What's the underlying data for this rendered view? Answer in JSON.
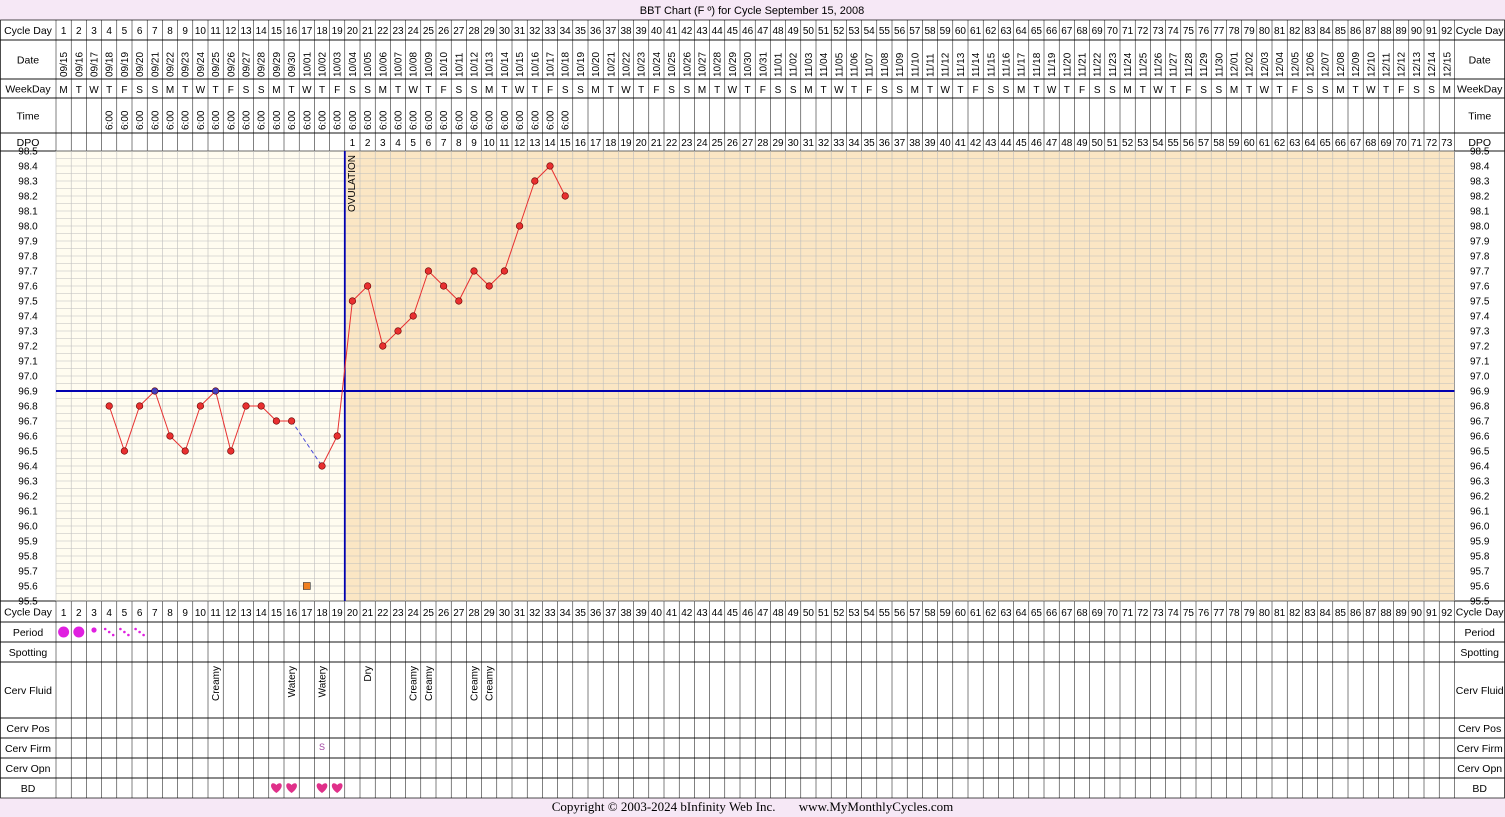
{
  "title": "BBT Chart (F º) for Cycle September 15, 2008",
  "labels": {
    "cycle_day": "Cycle Day",
    "date": "Date",
    "weekday": "WeekDay",
    "time": "Time",
    "dpo": "DPO",
    "period": "Period",
    "spotting": "Spotting",
    "cerv_fluid": "Cerv Fluid",
    "cerv_pos": "Cerv Pos",
    "cerv_firm": "Cerv Firm",
    "cerv_opn": "Cerv Opn",
    "bd": "BD"
  },
  "ovulation_label": "OVULATION",
  "copyright": "Copyright © 2003-2024 bInfinity Web Inc.",
  "site": "www.MyMonthlyCycles.com",
  "colors": {
    "background": "#f6e8f6",
    "pre_ovulation": "#fffcf0",
    "post_ovulation": "#fbe6c4",
    "grid": "#bdbdbd",
    "temp_line": "#e83030",
    "point_fill": "#e83030",
    "coverline": "#0000b0",
    "period_dot": "#e020e0",
    "bd_heart": "#e0308a",
    "marker": "#f08020"
  },
  "chart_data": {
    "type": "line",
    "title": "BBT Chart (F º) for Cycle September 15, 2008",
    "xlabel": "Cycle Day",
    "ylabel": "",
    "days": 92,
    "ylim": [
      95.5,
      98.5
    ],
    "y_ticks": [
      "98.5",
      "98.4",
      "98.3",
      "98.2",
      "98.1",
      "98.0",
      "97.9",
      "97.8",
      "97.7",
      "97.6",
      "97.5",
      "97.4",
      "97.3",
      "97.2",
      "97.1",
      "97.0",
      "96.9",
      "96.8",
      "96.7",
      "96.6",
      "96.5",
      "96.4",
      "96.3",
      "96.2",
      "96.1",
      "96.0",
      "95.9",
      "95.8",
      "95.7",
      "95.6",
      "95.5"
    ],
    "dates": [
      "09/15",
      "09/16",
      "09/17",
      "09/18",
      "09/19",
      "09/20",
      "09/21",
      "09/22",
      "09/23",
      "09/24",
      "09/25",
      "09/26",
      "09/27",
      "09/28",
      "09/29",
      "09/30",
      "10/01",
      "10/02",
      "10/03",
      "10/04",
      "10/05",
      "10/06",
      "10/07",
      "10/08",
      "10/09",
      "10/10",
      "10/11",
      "10/12",
      "10/13",
      "10/14",
      "10/15",
      "10/16",
      "10/17",
      "10/18",
      "10/19",
      "10/20",
      "10/21",
      "10/22",
      "10/23",
      "10/24",
      "10/25",
      "10/26",
      "10/27",
      "10/28",
      "10/29",
      "10/30",
      "10/31",
      "11/01",
      "11/02",
      "11/03",
      "11/04",
      "11/05",
      "11/06",
      "11/07",
      "11/08",
      "11/09",
      "11/10",
      "11/11",
      "11/12",
      "11/13",
      "11/14",
      "11/15",
      "11/16",
      "11/17",
      "11/18",
      "11/19",
      "11/20",
      "11/21",
      "11/22",
      "11/23",
      "11/24",
      "11/25",
      "11/26",
      "11/27",
      "11/28",
      "11/29",
      "11/30",
      "12/01",
      "12/02",
      "12/03",
      "12/04",
      "12/05",
      "12/06",
      "12/07",
      "12/08",
      "12/09",
      "12/10",
      "12/11",
      "12/12",
      "12/13",
      "12/14",
      "12/15"
    ],
    "weekdays": [
      "M",
      "T",
      "W",
      "T",
      "F",
      "S",
      "S",
      "M",
      "T",
      "W",
      "T",
      "F",
      "S",
      "S",
      "M",
      "T",
      "W",
      "T",
      "F",
      "S",
      "S",
      "M",
      "T",
      "W",
      "T",
      "F",
      "S",
      "S",
      "M",
      "T",
      "W",
      "T",
      "F",
      "S",
      "S",
      "M",
      "T",
      "W",
      "T",
      "F",
      "S",
      "S",
      "M",
      "T",
      "W",
      "T",
      "F",
      "S",
      "S",
      "M",
      "T",
      "W",
      "T",
      "F",
      "S",
      "S",
      "M",
      "T",
      "W",
      "T",
      "F",
      "S",
      "S",
      "M",
      "T",
      "W",
      "T",
      "F",
      "S",
      "S",
      "M",
      "T",
      "W",
      "T",
      "F",
      "S",
      "S",
      "M",
      "T",
      "W",
      "T",
      "F",
      "S",
      "S",
      "M",
      "T",
      "W",
      "T",
      "F",
      "S",
      "S",
      "M"
    ],
    "times": {
      "4": "6:00",
      "5": "6:00",
      "6": "6:00",
      "7": "6:00",
      "8": "6:00",
      "9": "6:00",
      "10": "6:00",
      "11": "6:00",
      "12": "6:00",
      "13": "6:00",
      "14": "6:00",
      "15": "6:00",
      "16": "6:00",
      "17": "6:00",
      "18": "6:00",
      "19": "6:00",
      "20": "6:00",
      "21": "6:00",
      "22": "6:00",
      "23": "6:00",
      "24": "6:00",
      "25": "6:00",
      "26": "6:00",
      "27": "6:00",
      "28": "6:00",
      "29": "6:00",
      "30": "6:00",
      "31": "6:00",
      "32": "6:00",
      "33": "6:00",
      "34": "6:00"
    },
    "dpo_start_day": 20,
    "dpo_count": 73,
    "temps": [
      {
        "day": 4,
        "temp": 96.8
      },
      {
        "day": 5,
        "temp": 96.5
      },
      {
        "day": 6,
        "temp": 96.8
      },
      {
        "day": 7,
        "temp": 96.9
      },
      {
        "day": 8,
        "temp": 96.6
      },
      {
        "day": 9,
        "temp": 96.5
      },
      {
        "day": 10,
        "temp": 96.8
      },
      {
        "day": 11,
        "temp": 96.9
      },
      {
        "day": 12,
        "temp": 96.5
      },
      {
        "day": 13,
        "temp": 96.8
      },
      {
        "day": 14,
        "temp": 96.8
      },
      {
        "day": 15,
        "temp": 96.7
      },
      {
        "day": 16,
        "temp": 96.7
      },
      {
        "day": 18,
        "temp": 96.4
      },
      {
        "day": 19,
        "temp": 96.6
      },
      {
        "day": 20,
        "temp": 97.5
      },
      {
        "day": 21,
        "temp": 97.6
      },
      {
        "day": 22,
        "temp": 97.2
      },
      {
        "day": 23,
        "temp": 97.3
      },
      {
        "day": 24,
        "temp": 97.4
      },
      {
        "day": 25,
        "temp": 97.7
      },
      {
        "day": 26,
        "temp": 97.6
      },
      {
        "day": 27,
        "temp": 97.5
      },
      {
        "day": 28,
        "temp": 97.7
      },
      {
        "day": 29,
        "temp": 97.6
      },
      {
        "day": 30,
        "temp": 97.7
      },
      {
        "day": 31,
        "temp": 98.0
      },
      {
        "day": 32,
        "temp": 98.3
      },
      {
        "day": 33,
        "temp": 98.4
      },
      {
        "day": 34,
        "temp": 98.2
      }
    ],
    "coverline": 96.9,
    "ovulation_day": 19,
    "other_markers": [
      {
        "day": 17,
        "temp": 95.6
      }
    ],
    "period": [
      {
        "day": 1,
        "level": "heavy"
      },
      {
        "day": 2,
        "level": "heavy"
      },
      {
        "day": 3,
        "level": "medium"
      },
      {
        "day": 4,
        "level": "light"
      },
      {
        "day": 5,
        "level": "light"
      },
      {
        "day": 6,
        "level": "light"
      }
    ],
    "cerv_fluid": {
      "11": "Creamy",
      "16": "Watery",
      "18": "Watery",
      "21": "Dry",
      "24": "Creamy",
      "25": "Creamy",
      "28": "Creamy",
      "29": "Creamy"
    },
    "cerv_firm": {
      "18": "S"
    },
    "bd_days": [
      15,
      16,
      18,
      19
    ],
    "legend": "none"
  }
}
